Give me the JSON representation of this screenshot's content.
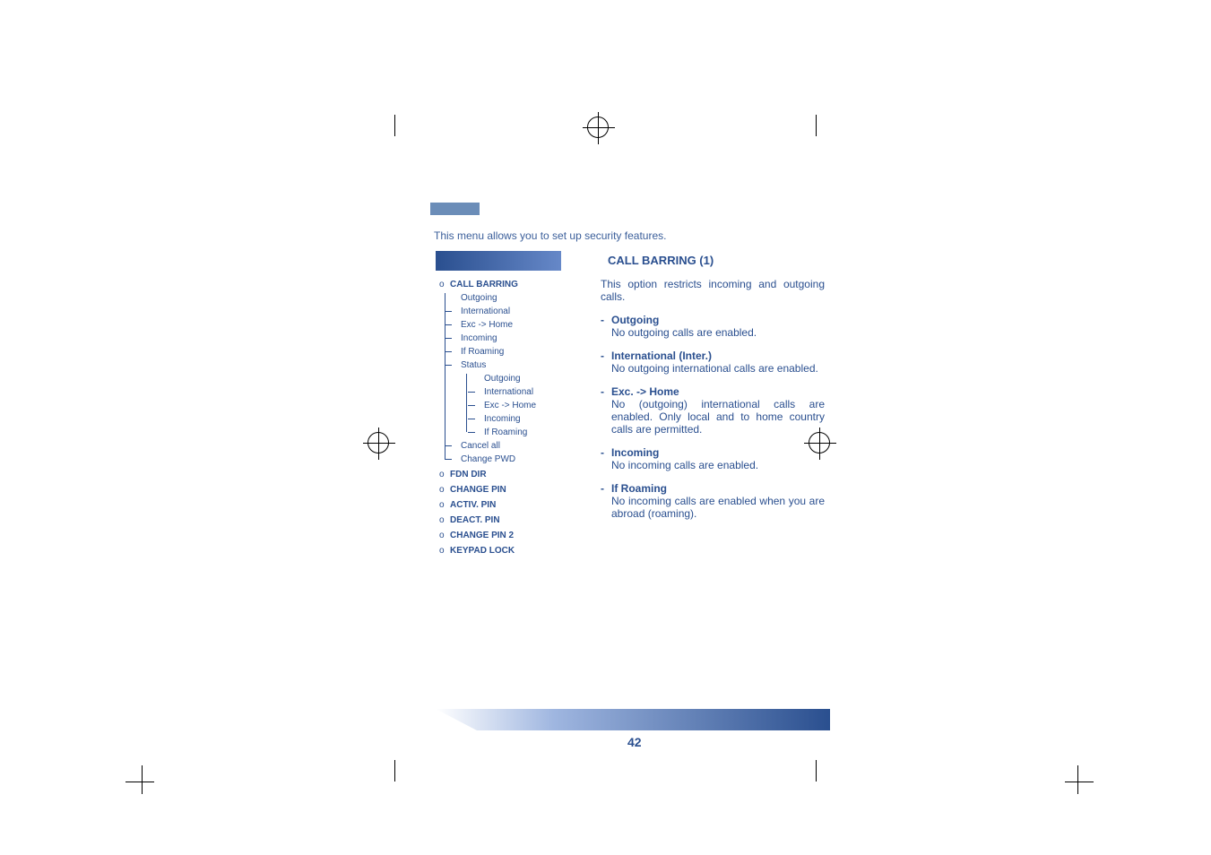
{
  "intro": "This menu allows you to set up security features.",
  "section": {
    "title": "CALL BARRING (1)"
  },
  "sidebar": {
    "items": [
      {
        "bullet": "o",
        "label": "CALL BARRING",
        "bold": true,
        "children": [
          {
            "label": "Outgoing"
          },
          {
            "label": "International"
          },
          {
            "label": "Exc -> Home"
          },
          {
            "label": "Incoming"
          },
          {
            "label": "If Roaming"
          },
          {
            "label": "Status",
            "children": [
              {
                "label": "Outgoing"
              },
              {
                "label": "International"
              },
              {
                "label": "Exc -> Home"
              },
              {
                "label": "Incoming"
              },
              {
                "label": "If Roaming"
              }
            ]
          },
          {
            "label": "Cancel all"
          },
          {
            "label": "Change PWD"
          }
        ]
      },
      {
        "bullet": "o",
        "label": "FDN DIR",
        "bold": true
      },
      {
        "bullet": "o",
        "label": "CHANGE PIN",
        "bold": true
      },
      {
        "bullet": "o",
        "label": "ACTIV. PIN",
        "bold": true
      },
      {
        "bullet": "o",
        "label": "DEACT. PIN",
        "bold": true
      },
      {
        "bullet": "o",
        "label": "CHANGE PIN 2",
        "bold": true
      },
      {
        "bullet": "o",
        "label": "KEYPAD LOCK",
        "bold": true
      }
    ]
  },
  "main": {
    "intro": "This option restricts incoming and outgoing calls.",
    "definitions": [
      {
        "term": "Outgoing",
        "desc": "No outgoing calls are enabled."
      },
      {
        "term": "International (Inter.)",
        "desc": "No outgoing international calls are enabled."
      },
      {
        "term": "Exc. -> Home",
        "desc": "No (outgoing) international calls are enabled. Only local and to home country calls are permitted."
      },
      {
        "term": "Incoming",
        "desc": "No incoming calls are enabled."
      },
      {
        "term": "If Roaming",
        "desc": "No incoming calls are enabled when you are abroad (roaming)."
      }
    ]
  },
  "pageNumber": "42"
}
